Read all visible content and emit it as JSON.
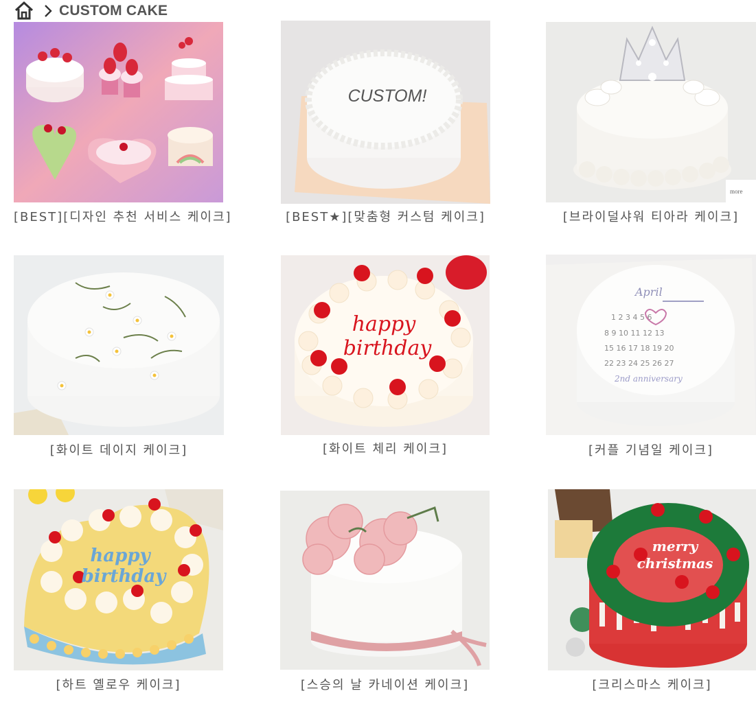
{
  "header": {
    "title": "CUSTOM CAKE"
  },
  "products": [
    {
      "caption": "[BEST][디자인 추천 서비스 케이크]",
      "image": "cake-collage-image"
    },
    {
      "caption": "[BEST★][맞춤형 커스텀 케이크]",
      "image": "custom-lettering-cake-image",
      "image_text": "CUSTOM!"
    },
    {
      "caption": "[브라이덜샤워 티아라 케이크]",
      "image": "tiara-cake-image"
    },
    {
      "caption": "[화이트 데이지 케이크]",
      "image": "daisy-cake-image"
    },
    {
      "caption": "[화이트 체리 케이크]",
      "image": "cherry-birthday-cake-image",
      "image_text": "happy birthday"
    },
    {
      "caption": "[커플 기념일 케이크]",
      "image": "calendar-anniversary-cake-image",
      "image_text": "April"
    },
    {
      "caption": "[하트 옐로우 케이크]",
      "image": "yellow-heart-cake-image",
      "image_text": "happy birthday"
    },
    {
      "caption": "[스승의 날 카네이션 케이크]",
      "image": "carnation-cake-image"
    },
    {
      "caption": "[크리스마스 케이크]",
      "image": "christmas-cake-image",
      "image_text": "merry christmas"
    }
  ],
  "colors": {
    "caption_text": "#555555",
    "title_text": "#555555",
    "icon": "#333333"
  }
}
